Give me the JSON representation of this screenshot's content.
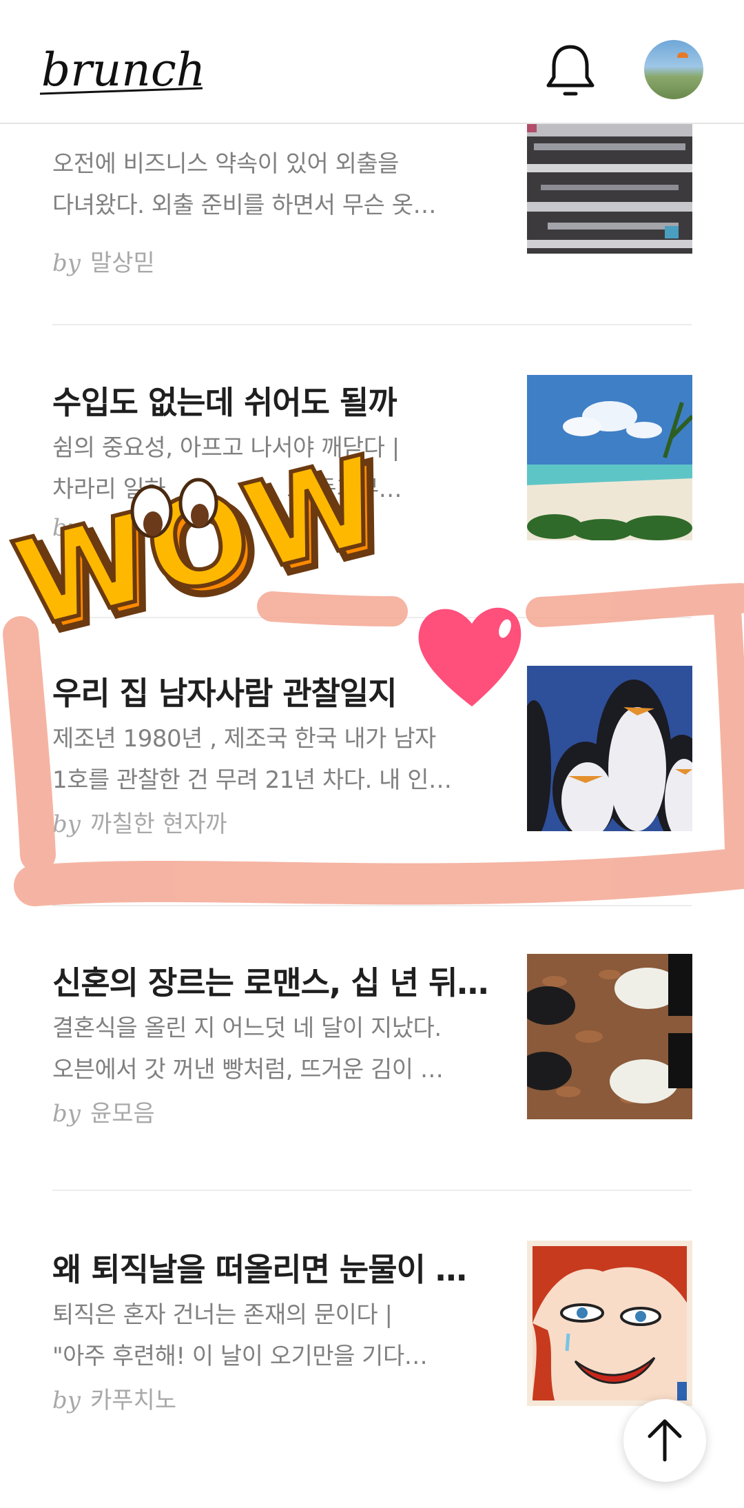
{
  "app": {
    "logo_text": "brunch"
  },
  "header": {
    "icons": [
      "bell-icon",
      "avatar"
    ]
  },
  "articles": [
    {
      "title": "",
      "excerpt": [
        "오전에 비즈니스 약속이 있어 외출을",
        "다녀왔다. 외출 준비를 하면서 무슨 옷…"
      ],
      "by": "by",
      "author": "말상믿"
    },
    {
      "title": "수입도 없는데 쉬어도 될까",
      "excerpt": [
        "쉼의 중요성, 아프고 나서야 깨닫다 |",
        " 차라리 일하"
      ],
      "excerpt_tail": "로 동기부…",
      "by": "by",
      "author": ""
    },
    {
      "title": "우리 집 남자사람 관찰일지",
      "excerpt": [
        "제조년 1980년 , 제조국 한국 내가 남자",
        "1호를 관찰한 건 무려 21년 차다. 내 인…"
      ],
      "by": "by",
      "author": "까칠한 현자까"
    },
    {
      "title": "신혼의 장르는 로맨스, 십 년 뒤…",
      "excerpt": [
        "결혼식을 올린 지 어느덧 네 달이 지났다.",
        "오븐에서 갓 꺼낸 빵처럼, 뜨거운 김이 …"
      ],
      "by": "by",
      "author": "윤모음"
    },
    {
      "title": "왜 퇴직날을 떠올리면 눈물이 …",
      "excerpt": [
        "퇴직은 혼자 건너는 존재의 문이다 |",
        " \"아주 후련해! 이 날이 오기만을 기다…"
      ],
      "by": "by",
      "author": "카푸치노"
    }
  ],
  "stickers": {
    "wow_text": "WOW"
  },
  "colors": {
    "highlight": "#f4a48f",
    "heart": "#ff4f7b",
    "wow": "#ffb800"
  }
}
